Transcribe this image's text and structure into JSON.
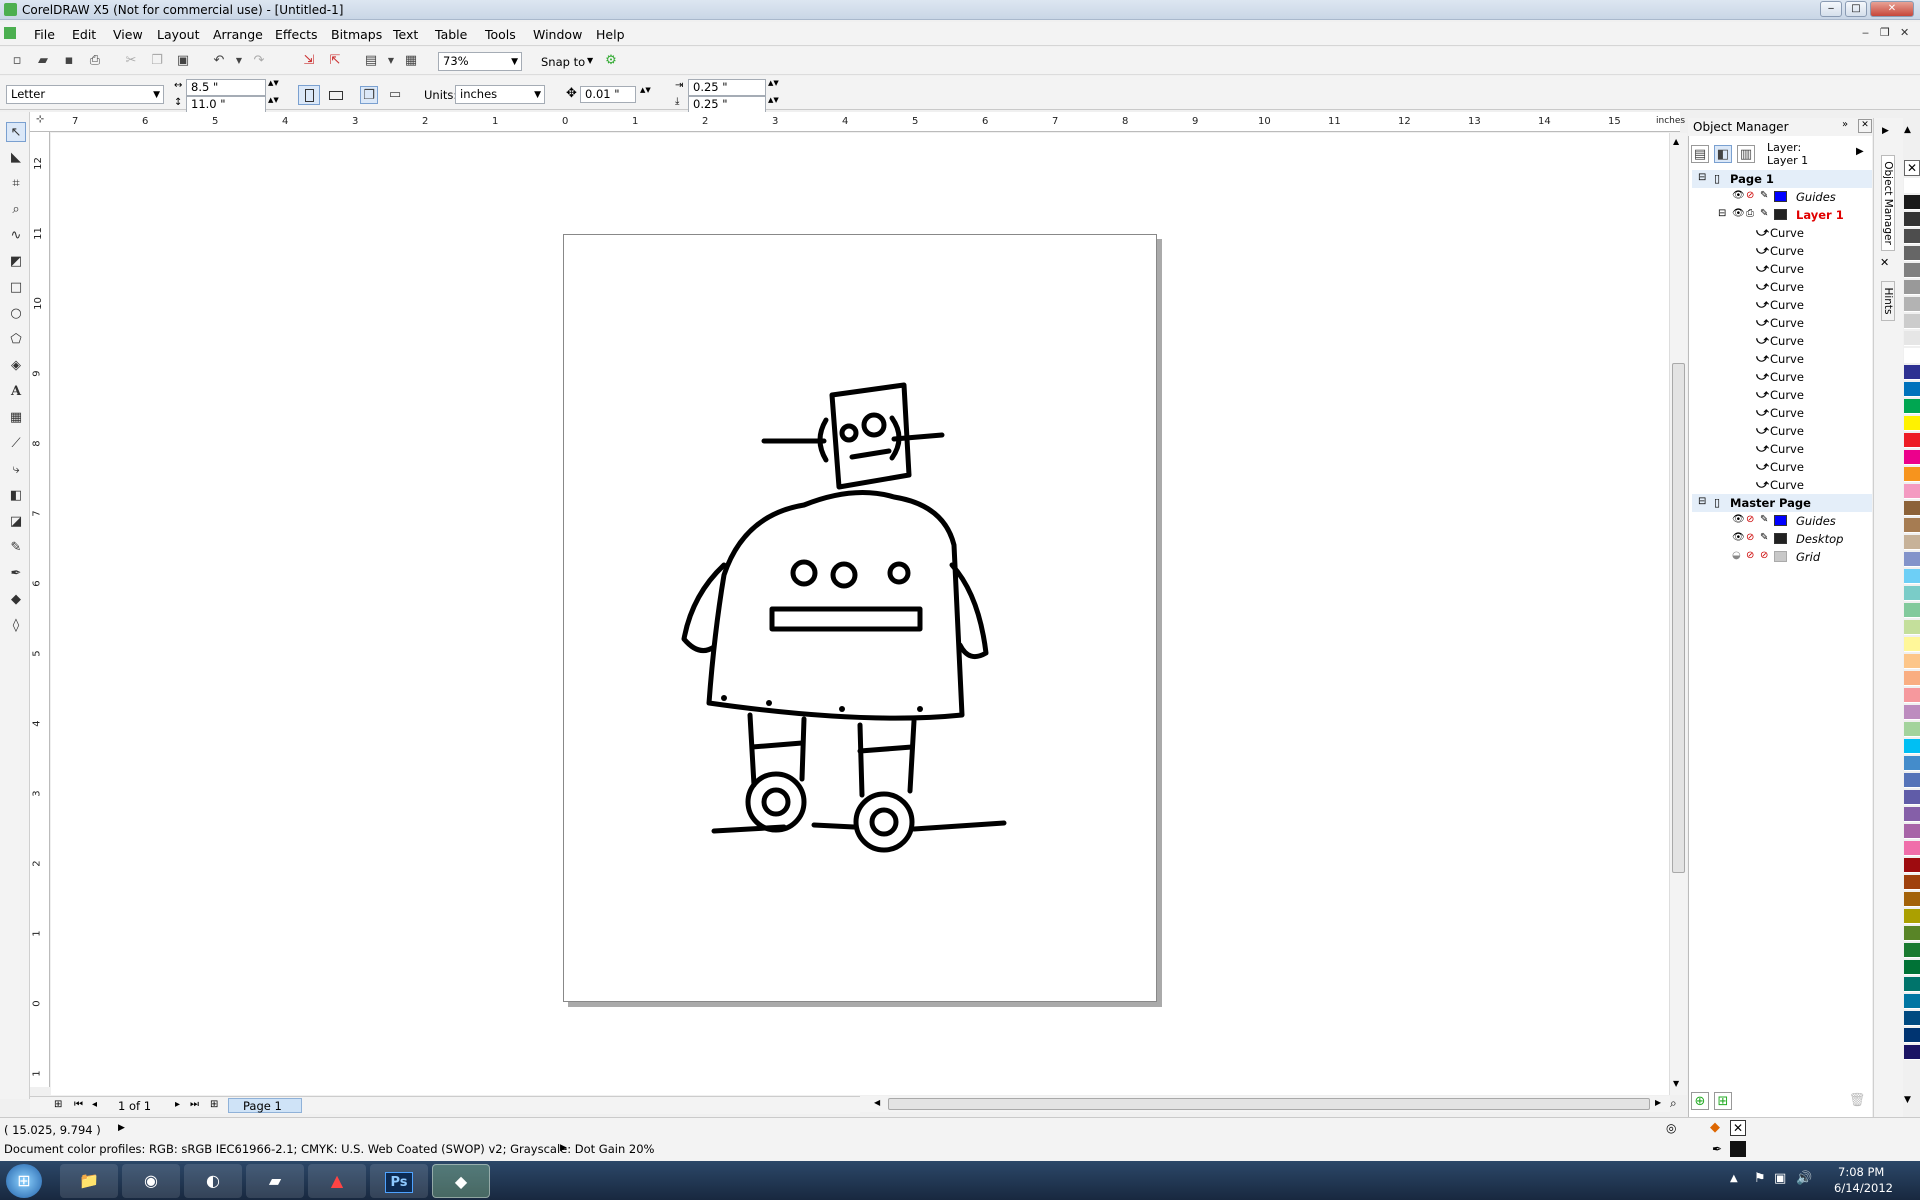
{
  "window": {
    "title": "CorelDRAW X5 (Not for commercial use) - [Untitled-1]",
    "minimize": "‒",
    "maximize": "□",
    "close": "✕",
    "doc_minimize": "‒",
    "doc_restore": "❐",
    "doc_close": "✕"
  },
  "menu": [
    "File",
    "Edit",
    "View",
    "Layout",
    "Arrange",
    "Effects",
    "Bitmaps",
    "Text",
    "Table",
    "Tools",
    "Window",
    "Help"
  ],
  "toolbar": {
    "zoom": "73%",
    "snap_to": "Snap to"
  },
  "property_bar": {
    "page_size": "Letter",
    "width": "8.5 \"",
    "height": "11.0 \"",
    "units_label": "Units:",
    "units": "inches",
    "nudge": "0.01 \"",
    "dup_x": "0.25 \"",
    "dup_y": "0.25 \""
  },
  "rulers": {
    "unit": "inches",
    "h_ticks": [
      "7",
      "6",
      "5",
      "4",
      "3",
      "2",
      "1",
      "0",
      "1",
      "2",
      "3",
      "4",
      "5",
      "6",
      "7",
      "8",
      "9",
      "10",
      "11",
      "12",
      "13",
      "14",
      "15"
    ],
    "v_ticks": [
      "12",
      "11",
      "10",
      "9",
      "8",
      "7",
      "6",
      "5",
      "4",
      "3",
      "2",
      "1",
      "0",
      "1"
    ],
    "v_unit": "inches"
  },
  "page_nav": {
    "counter": "1 of 1",
    "tab": "Page 1"
  },
  "object_manager": {
    "title": "Object Manager",
    "layer_label": "Layer:",
    "layer_name": "Layer 1",
    "rows": [
      {
        "text": "Page 1",
        "level": 0,
        "kind": "page"
      },
      {
        "text": "Guides",
        "level": 1,
        "kind": "layer",
        "color": "#0000ff",
        "italic": true
      },
      {
        "text": "Layer 1",
        "level": 1,
        "kind": "active-layer",
        "color": "#222222"
      },
      {
        "text": "Curve",
        "level": 2,
        "kind": "curve"
      },
      {
        "text": "Curve",
        "level": 2,
        "kind": "curve"
      },
      {
        "text": "Curve",
        "level": 2,
        "kind": "curve"
      },
      {
        "text": "Curve",
        "level": 2,
        "kind": "curve"
      },
      {
        "text": "Curve",
        "level": 2,
        "kind": "curve"
      },
      {
        "text": "Curve",
        "level": 2,
        "kind": "curve"
      },
      {
        "text": "Curve",
        "level": 2,
        "kind": "curve"
      },
      {
        "text": "Curve",
        "level": 2,
        "kind": "curve"
      },
      {
        "text": "Curve",
        "level": 2,
        "kind": "curve"
      },
      {
        "text": "Curve",
        "level": 2,
        "kind": "curve"
      },
      {
        "text": "Curve",
        "level": 2,
        "kind": "curve"
      },
      {
        "text": "Curve",
        "level": 2,
        "kind": "curve"
      },
      {
        "text": "Curve",
        "level": 2,
        "kind": "curve"
      },
      {
        "text": "Curve",
        "level": 2,
        "kind": "curve"
      },
      {
        "text": "Curve",
        "level": 2,
        "kind": "curve"
      },
      {
        "text": "Master Page",
        "level": 0,
        "kind": "page"
      },
      {
        "text": "Guides",
        "level": 1,
        "kind": "layer",
        "color": "#0000ff",
        "italic": true
      },
      {
        "text": "Desktop",
        "level": 1,
        "kind": "layer",
        "color": "#222222",
        "italic": true
      },
      {
        "text": "Grid",
        "level": 1,
        "kind": "layer",
        "color": "#c8c8c8",
        "italic": true
      }
    ]
  },
  "docker_tabs": [
    "Object Manager",
    "Hints"
  ],
  "palette": [
    "#ffffff",
    "#1a1a1a",
    "#333333",
    "#4d4d4d",
    "#666666",
    "#808080",
    "#999999",
    "#b3b3b3",
    "#cccccc",
    "#e6e6e6",
    "#ffffff",
    "#2e3192",
    "#0072bc",
    "#00a651",
    "#fff200",
    "#ed1c24",
    "#ec008c",
    "#f7941d",
    "#f49ac1",
    "#8c6239",
    "#a67c52",
    "#c7b299",
    "#8393ca",
    "#6dcff6",
    "#7accc8",
    "#82ca9c",
    "#c4df9b",
    "#fff799",
    "#fdc689",
    "#f9ad81",
    "#f6989d",
    "#bd8cbf",
    "#a3d39c",
    "#00bff3",
    "#448ccb",
    "#5674b9",
    "#605ca8",
    "#855fa8",
    "#a864a8",
    "#f06eaa",
    "#9e0b0f",
    "#a0410d",
    "#a36209",
    "#aba000",
    "#598527",
    "#1a7b30",
    "#007236",
    "#00746b",
    "#0076a3",
    "#004a80",
    "#003471",
    "#1b1464"
  ],
  "status": {
    "coords": "( 15.025, 9.794 )",
    "profiles": "Document color profiles: RGB: sRGB IEC61966-2.1; CMYK: U.S. Web Coated (SWOP) v2; Grayscale: Dot Gain 20%"
  },
  "taskbar": {
    "time": "7:08 PM",
    "date": "6/14/2012",
    "apps": [
      "explorer",
      "chrome",
      "firefox",
      "archive",
      "acrobat",
      "photoshop",
      "coreldraw"
    ]
  }
}
